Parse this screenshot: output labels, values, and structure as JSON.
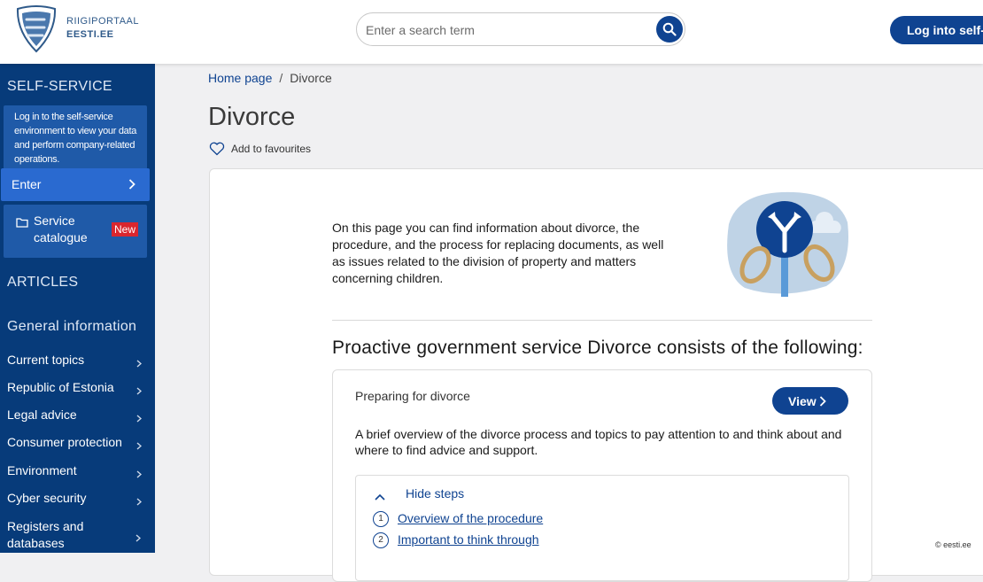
{
  "header": {
    "logo_line1": "RIIGIPORTAAL",
    "logo_line2": "EESTI.EE",
    "search_placeholder": "Enter a search term",
    "login_label": "Log into self-se"
  },
  "sidebar": {
    "self_service_title": "SELF-SERVICE",
    "login_prompt": "Log in to the self-service environment to view your data and perform company-related operations.",
    "enter_label": "Enter",
    "catalogue_label": "Service catalogue",
    "catalogue_badge": "New",
    "articles_title": "ARTICLES",
    "general_info_title": "General information",
    "items": [
      {
        "label": "Current topics"
      },
      {
        "label": "Republic of Estonia"
      },
      {
        "label": "Legal advice"
      },
      {
        "label": "Consumer protection"
      },
      {
        "label": "Environment"
      },
      {
        "label": "Cyber security"
      },
      {
        "label": "Registers and databases"
      }
    ]
  },
  "main": {
    "breadcrumb_home": "Home page",
    "breadcrumb_sep": "/",
    "breadcrumb_current": "Divorce",
    "title": "Divorce",
    "favourites_label": "Add to favourites",
    "intro": "On this page you can find information about divorce, the procedure, and the process for replacing documents, as well as issues related to the division of property and matters concerning children.",
    "section_title": "Proactive government service Divorce consists of the following:",
    "service": {
      "title": "Preparing for divorce",
      "view_label": "View",
      "description": "A brief overview of the divorce process and topics to pay attention to and think about and where to find advice and support.",
      "hide_steps_label": "Hide steps",
      "steps": [
        {
          "num": "1",
          "label": "Overview of the procedure"
        },
        {
          "num": "2",
          "label": "Important to think through"
        }
      ]
    }
  },
  "footer": {
    "copyright": "© eesti.ee"
  },
  "colors": {
    "primary": "#0f4391",
    "sidebar": "#073b7a",
    "badge": "#d9262e"
  }
}
